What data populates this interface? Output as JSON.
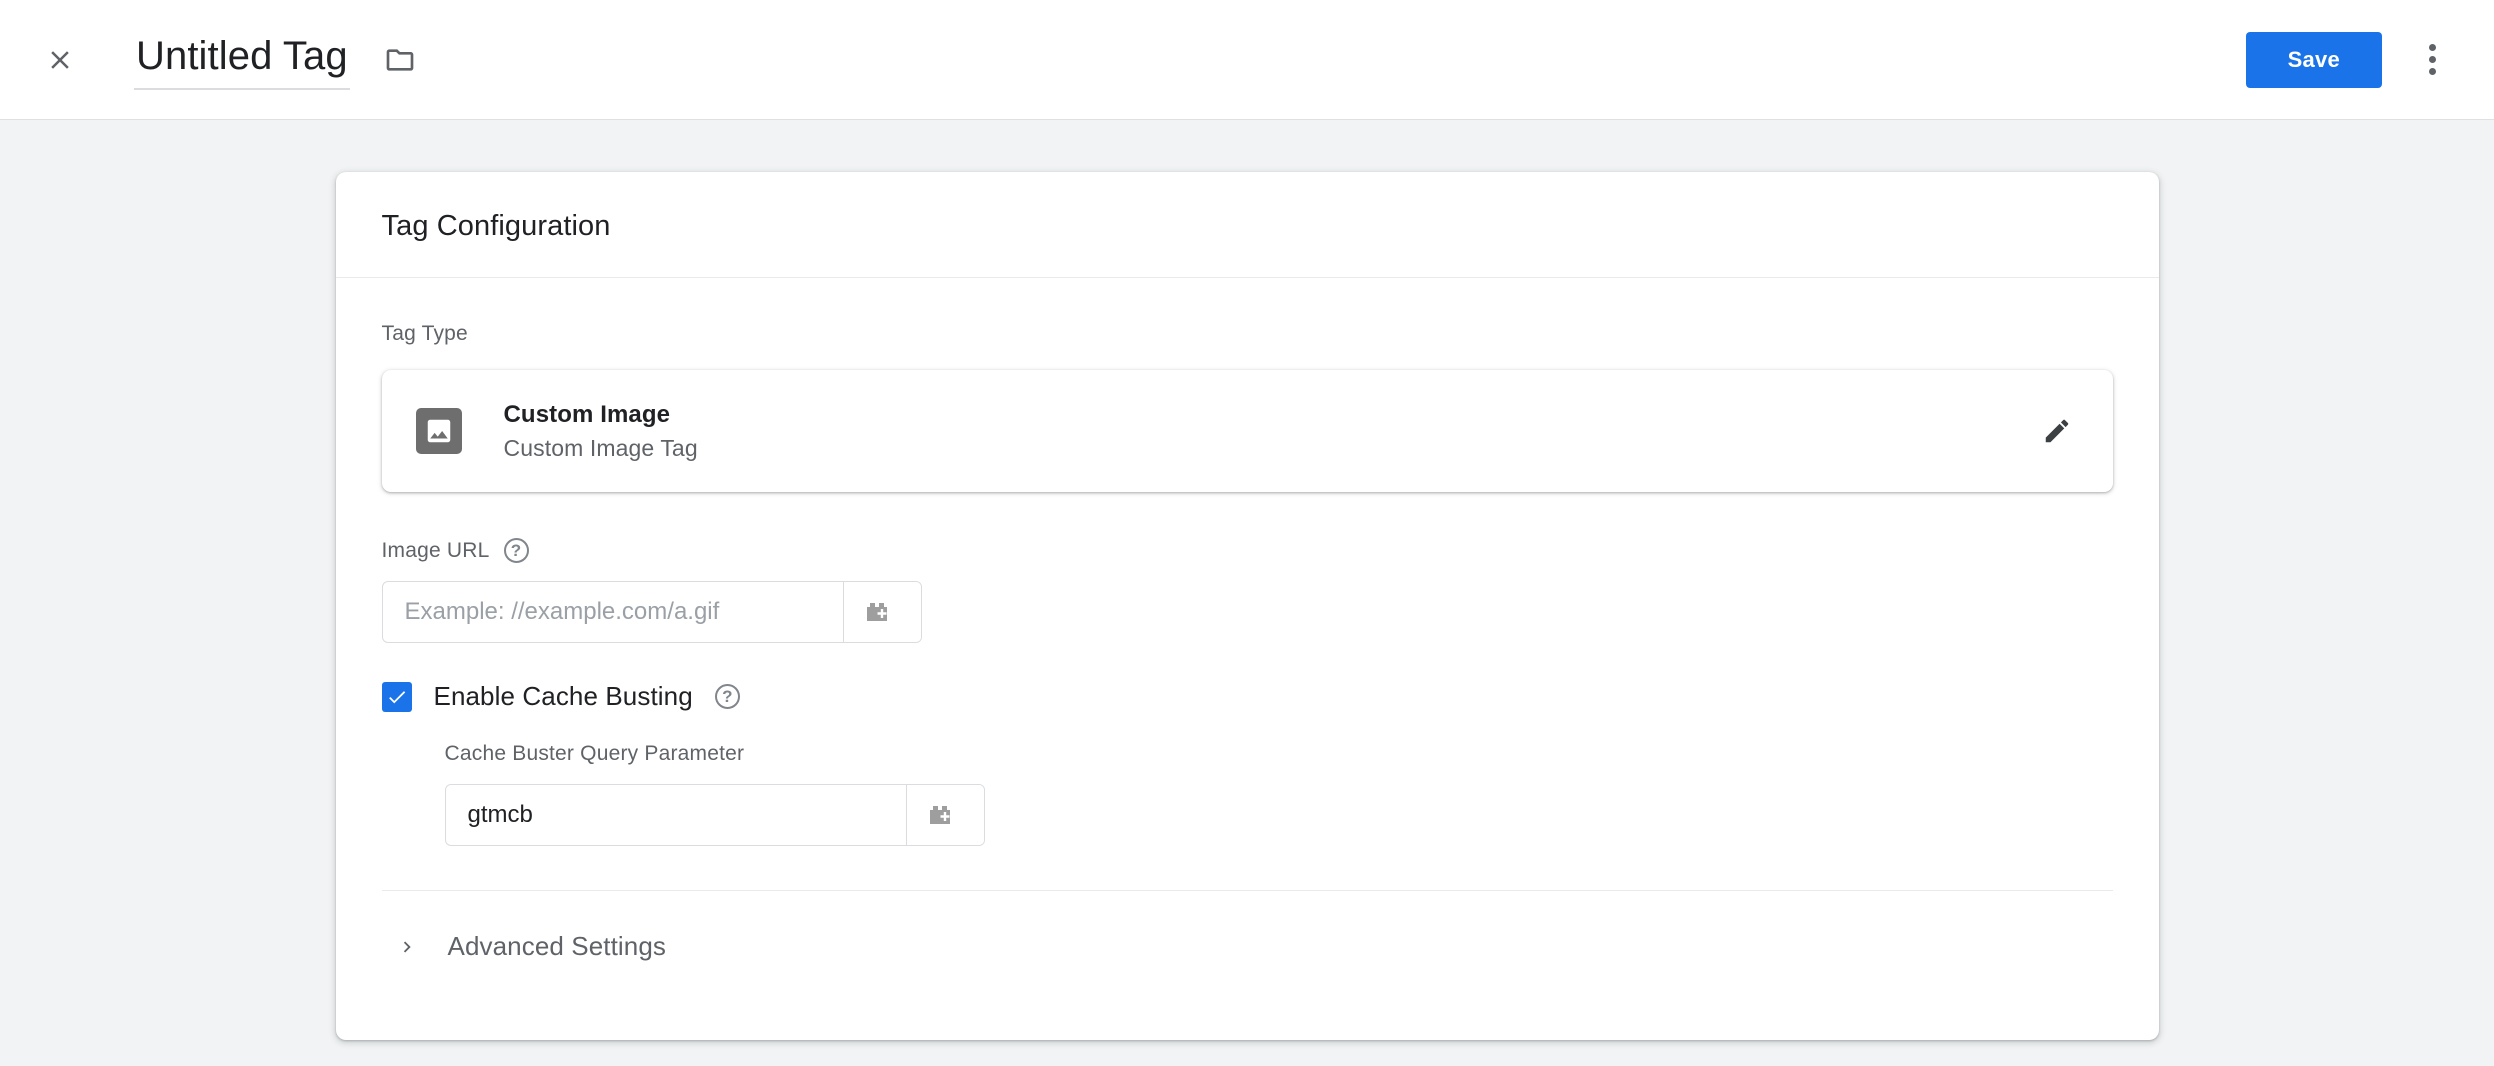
{
  "appbar": {
    "close_icon": "close-icon",
    "title": "Untitled Tag",
    "folder_icon": "folder-icon",
    "save_label": "Save",
    "more_icon": "more-vert-icon"
  },
  "card": {
    "heading": "Tag Configuration",
    "tag_type": {
      "label": "Tag Type",
      "icon": "image-icon",
      "name": "Custom Image",
      "description": "Custom Image Tag",
      "edit_icon": "pencil-icon"
    },
    "image_url": {
      "label": "Image URL",
      "help_icon": "help-circle-icon",
      "value": "",
      "placeholder": "Example: //example.com/a.gif",
      "variable_picker_icon": "variable-block-plus-icon"
    },
    "cache_busting": {
      "checked": true,
      "label": "Enable Cache Busting",
      "help_icon": "help-circle-icon",
      "param_label": "Cache Buster Query Parameter",
      "param_value": "gtmcb",
      "param_placeholder": "",
      "variable_picker_icon": "variable-block-plus-icon"
    },
    "advanced": {
      "chevron_icon": "chevron-right-icon",
      "label": "Advanced Settings"
    }
  },
  "colors": {
    "accent": "#1a73e8",
    "page_background": "#f1f3f4",
    "surface": "#ffffff",
    "text_primary": "#202124",
    "text_secondary": "#5f6368"
  }
}
